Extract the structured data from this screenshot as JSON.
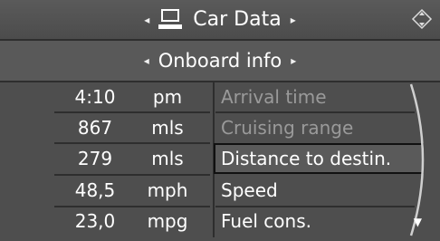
{
  "header": {
    "title": "Car Data",
    "left_arrow": "◂",
    "right_arrow": "▸"
  },
  "subheader": {
    "title": "Onboard info",
    "left_arrow": "◂",
    "right_arrow": "▸"
  },
  "rows": [
    {
      "value": "4:10",
      "unit": "pm",
      "label": "Arrival time",
      "state": "dim"
    },
    {
      "value": "867",
      "unit": "mls",
      "label": "Cruising range",
      "state": "dim"
    },
    {
      "value": "279",
      "unit": "mls",
      "label": "Distance to destin.",
      "state": "selected"
    },
    {
      "value": "48,5",
      "unit": "mph",
      "label": "Speed",
      "state": "normal"
    },
    {
      "value": "23,0",
      "unit": "mpg",
      "label": "Fuel cons.",
      "state": "normal"
    }
  ],
  "scroll_indicator": "▼"
}
